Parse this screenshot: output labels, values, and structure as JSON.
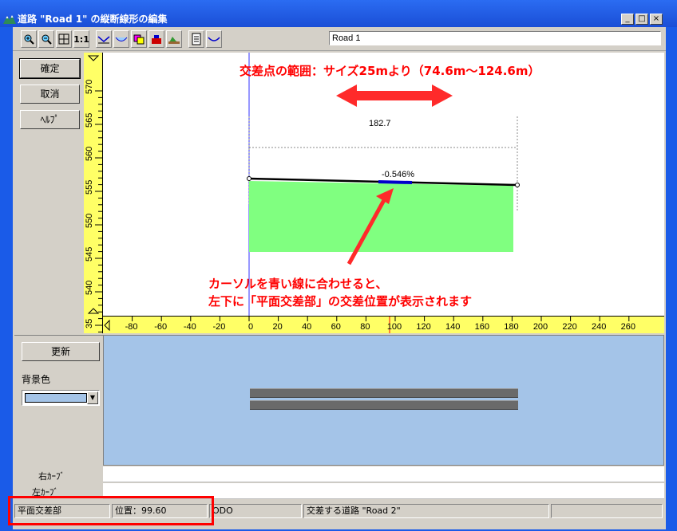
{
  "window": {
    "title": "道路 \"Road 1\" の縦断線形の編集",
    "controls": [
      "_",
      "□",
      "×"
    ]
  },
  "toolbar": {
    "zoom_1to1": "1:1",
    "road_name": "Road 1",
    "icons": [
      "zoom-in-icon",
      "zoom-out-icon",
      "fit-icon",
      "one-to-one-icon",
      "profile-icon",
      "section-icon",
      "color-icon",
      "bridge-icon",
      "terrain-icon",
      "document-icon",
      "road-icon"
    ]
  },
  "left_panel": {
    "confirm": "確定",
    "cancel": "取消",
    "help": "ﾍﾙﾌﾟ"
  },
  "vruler": {
    "labels": [
      "570",
      "565",
      "560",
      "555",
      "550",
      "545",
      "540",
      "35"
    ]
  },
  "hruler": {
    "labels": [
      "-80",
      "-60",
      "-40",
      "-20",
      "0",
      "20",
      "40",
      "60",
      "80",
      "100",
      "120",
      "140",
      "160",
      "180",
      "200",
      "220",
      "240",
      "260"
    ]
  },
  "profile": {
    "length_label": "182.7",
    "slope_label": "-0.546%"
  },
  "bottom_left": {
    "refresh": "更新",
    "bg_color_label": "背景色",
    "bg_color": "#a4c4e8"
  },
  "curves": {
    "right": "右ｶｰﾌﾞ",
    "left": "左ｶｰﾌﾞ"
  },
  "statusbar": {
    "mode": "平面交差部",
    "position": "位置：99.60",
    "code": "ODO",
    "crossing_road": "交差する道路 \"Road 2\""
  },
  "annotations": {
    "range_note": "交差点の範囲：サイズ25mより（74.6m～124.6m）",
    "hint_line1": "カーソルを青い線に合わせると、",
    "hint_line2": "左下に「平面交差部」の交差位置が表示されます"
  },
  "colors": {
    "fill_green": "#80ff80",
    "ruler_yellow": "#ffff66",
    "accent_red": "#ff0000",
    "slope_blue": "#0000cc"
  }
}
